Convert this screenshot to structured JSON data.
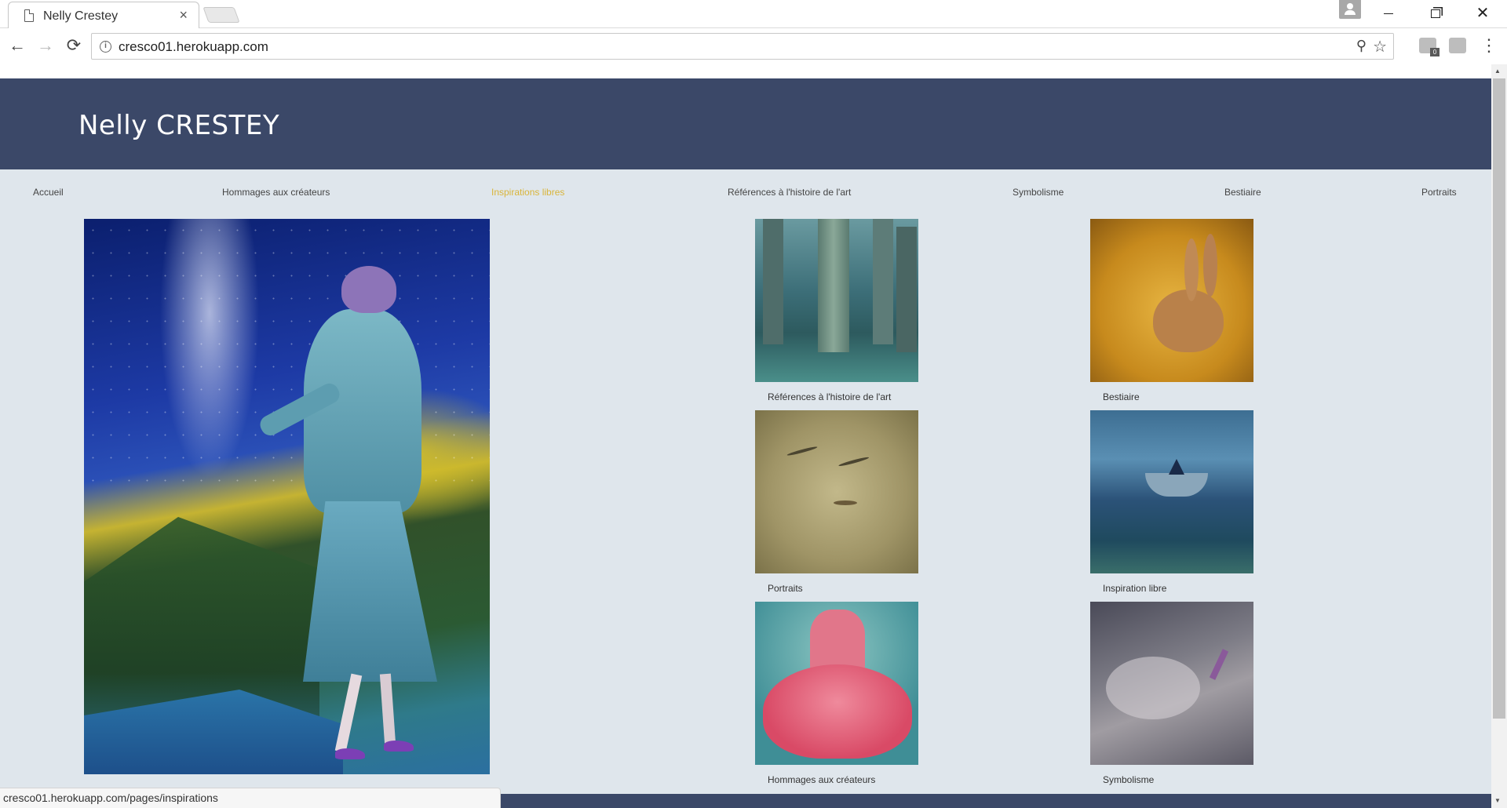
{
  "browser": {
    "tab_title": "Nelly Crestey",
    "tab_close": "×",
    "url": "cresco01.herokuapp.com",
    "status_url": "cresco01.herokuapp.com/pages/inspirations",
    "extension_badge": "0",
    "buttons": {
      "back": "←",
      "forward": "→",
      "reload": "⟳",
      "zoom": "⚲",
      "star": "☆",
      "menu": "⋮",
      "close": "✕"
    }
  },
  "site": {
    "title": "Nelly CRESTEY",
    "nav": [
      {
        "label": "Accueil",
        "active": false
      },
      {
        "label": "Hommages aux créateurs",
        "active": false
      },
      {
        "label": "Inspirations libres",
        "active": true
      },
      {
        "label": "Références à l'histoire de l'art",
        "active": false
      },
      {
        "label": "Symbolisme",
        "active": false
      },
      {
        "label": "Bestiaire",
        "active": false
      },
      {
        "label": "Portraits",
        "active": false
      }
    ],
    "gallery": [
      {
        "caption": "Références à l'histoire de l'art"
      },
      {
        "caption": "Bestiaire"
      },
      {
        "caption": "Portraits"
      },
      {
        "caption": "Inspiration libre"
      },
      {
        "caption": "Hommages aux créateurs"
      },
      {
        "caption": "Symbolisme"
      }
    ]
  },
  "colors": {
    "header": "#3b4868",
    "page_bg": "#dfe6ec",
    "active_nav": "#d9b53a"
  }
}
